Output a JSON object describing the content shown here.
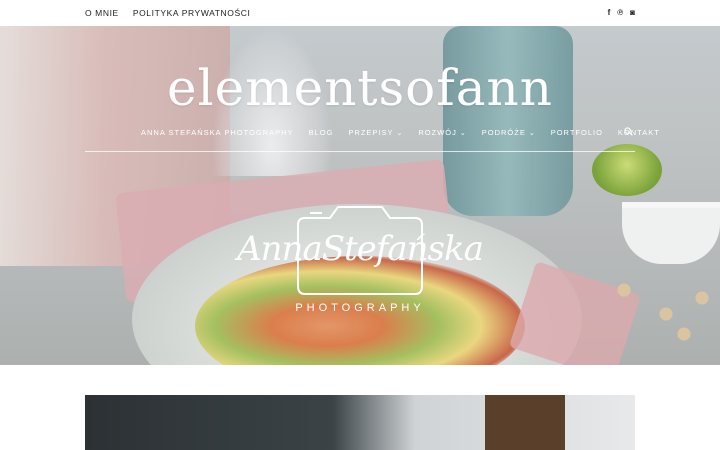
{
  "top_bar": {
    "links": [
      "O MNIE",
      "POLITYKA PRYWATNOŚCI"
    ],
    "social_icons": [
      {
        "name": "facebook-icon",
        "glyph": "f"
      },
      {
        "name": "pinterest-icon",
        "glyph": "℗"
      },
      {
        "name": "instagram-icon",
        "glyph": "◙"
      }
    ]
  },
  "header": {
    "site_title": "elementsofann"
  },
  "nav": {
    "items": [
      {
        "label": "ANNA STEFAŃSKA PHOTOGRAPHY",
        "has_dropdown": false
      },
      {
        "label": "BLOG",
        "has_dropdown": false
      },
      {
        "label": "PRZEPISY",
        "has_dropdown": true
      },
      {
        "label": "ROZWÓJ",
        "has_dropdown": true
      },
      {
        "label": "PODRÓŻE",
        "has_dropdown": true
      },
      {
        "label": "PORTFOLIO",
        "has_dropdown": false
      },
      {
        "label": "KONTAKT",
        "has_dropdown": false
      }
    ],
    "dropdown_glyph": "⌄",
    "search_icon": "search-icon"
  },
  "hero_logo": {
    "script_text": "AnnaStefańska",
    "subtitle": "PHOTOGRAPHY"
  },
  "colors": {
    "text_dark": "#222222",
    "nav_text": "#ffffff"
  }
}
